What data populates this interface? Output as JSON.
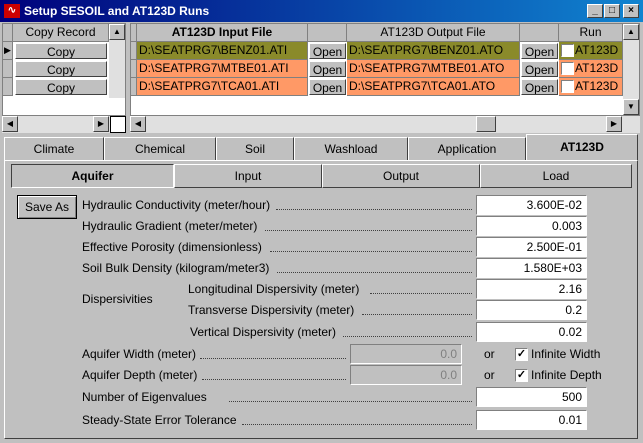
{
  "window": {
    "title": "Setup SESOIL and AT123D Runs",
    "minimize": "_",
    "maximize": "□",
    "close": "×"
  },
  "grid": {
    "headers": {
      "copy": "Copy Record",
      "input": "AT123D Input File",
      "output": "AT123D Output File",
      "run": "Run"
    },
    "rows": [
      {
        "copy": "Copy",
        "input": "D:\\SEATPRG7\\BENZ01.ATI",
        "open1": "Open",
        "output": "D:\\SEATPRG7\\BENZ01.ATO",
        "open2": "Open",
        "run": "AT123D",
        "color": "#8a8a2a"
      },
      {
        "copy": "Copy",
        "input": "D:\\SEATPRG7\\MTBE01.ATI",
        "open1": "Open",
        "output": "D:\\SEATPRG7\\MTBE01.ATO",
        "open2": "Open",
        "run": "AT123D",
        "color": "#ff9966"
      },
      {
        "copy": "Copy",
        "input": "D:\\SEATPRG7\\TCA01.ATI",
        "open1": "Open",
        "output": "D:\\SEATPRG7\\TCA01.ATO",
        "open2": "Open",
        "run": "AT123D",
        "color": "#ff9966"
      }
    ]
  },
  "tabs": [
    "Climate",
    "Chemical",
    "Soil",
    "Washload",
    "Application",
    "AT123D"
  ],
  "active_tab": "AT123D",
  "subtabs": [
    "Aquifer",
    "Input",
    "Output",
    "Load"
  ],
  "active_subtab": "Aquifer",
  "save_as": "Save As",
  "aquifer": {
    "hyd_cond": {
      "label": "Hydraulic Conductivity (meter/hour)",
      "value": "3.600E-02"
    },
    "hyd_grad": {
      "label": "Hydraulic Gradient (meter/meter)",
      "value": "0.003"
    },
    "porosity": {
      "label": "Effective Porosity (dimensionless)",
      "value": "2.500E-01"
    },
    "bulk_density": {
      "label": "Soil Bulk Density (kilogram/meter3)",
      "value": "1.580E+03"
    },
    "dispersivities_label": "Dispersivities",
    "long_disp": {
      "label": "Longitudinal Dispersivity (meter)",
      "value": "2.16"
    },
    "trans_disp": {
      "label": "Transverse Dispersivity (meter)",
      "value": "0.2"
    },
    "vert_disp": {
      "label": "Vertical Dispersivity (meter)",
      "value": "0.02"
    },
    "width": {
      "label": "Aquifer Width (meter)",
      "value": "0.0",
      "or": "or",
      "infinite": "Infinite Width",
      "checked": true
    },
    "depth": {
      "label": "Aquifer Depth (meter)",
      "value": "0.0",
      "or": "or",
      "infinite": "Infinite Depth",
      "checked": true
    },
    "eigen": {
      "label": "Number of Eigenvalues",
      "value": "500"
    },
    "tolerance": {
      "label": "Steady-State Error Tolerance",
      "value": "0.01"
    }
  }
}
